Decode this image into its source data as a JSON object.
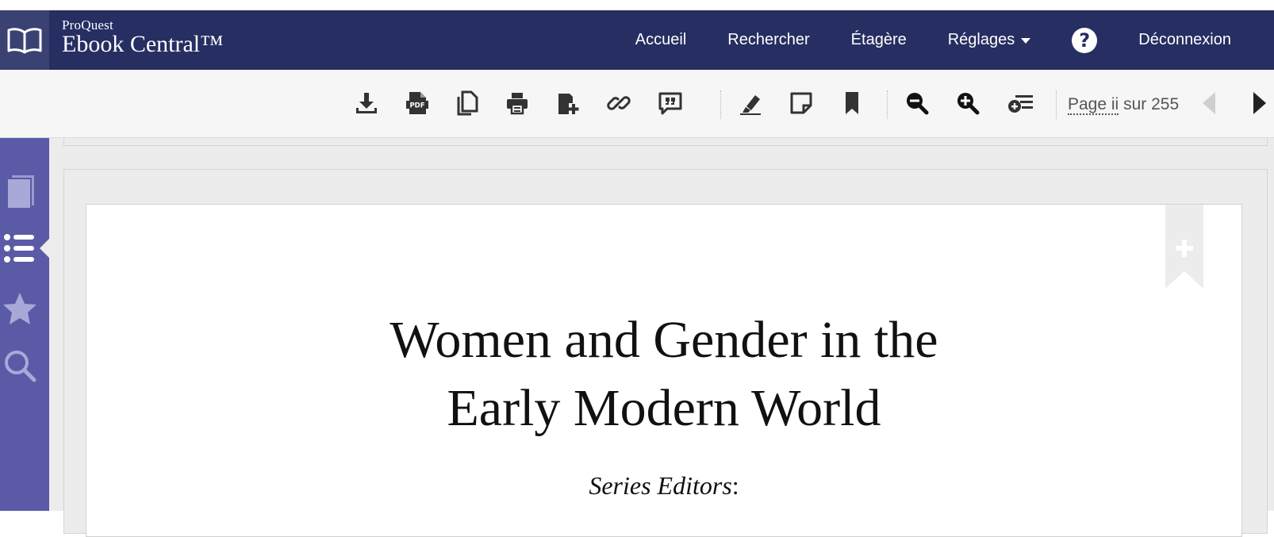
{
  "app": {
    "brand_small": "ProQuest",
    "brand_large": "Ebook Central™",
    "colors": {
      "header": "#262e62",
      "sidebar": "#5a5aa7",
      "toolbar": "#f6f6f6"
    }
  },
  "nav": {
    "home": "Accueil",
    "search": "Rechercher",
    "shelf": "Étagère",
    "settings": "Réglages",
    "help_glyph": "?",
    "logout": "Déconnexion"
  },
  "toolbar": {
    "icons": [
      "download-icon",
      "pdf-icon",
      "copy-icon",
      "print-icon",
      "add-to-shelf-icon",
      "link-icon",
      "cite-icon",
      "highlight-icon",
      "note-icon",
      "bookmark-icon",
      "zoom-out-icon",
      "zoom-in-icon",
      "add-to-list-icon"
    ],
    "pdf_label": "PDF",
    "page_label": "Page",
    "page_current": "ii",
    "page_total_text": "sur 255"
  },
  "sidebar": {
    "icons": [
      "book-icon",
      "table-of-contents-icon",
      "favorites-star-icon",
      "search-icon"
    ],
    "active_index": 1
  },
  "document": {
    "title_line1": "Women and Gender in the",
    "title_line2": "Early Modern World",
    "subtitle_italic": "Series Editors",
    "subtitle_punct": ":"
  }
}
